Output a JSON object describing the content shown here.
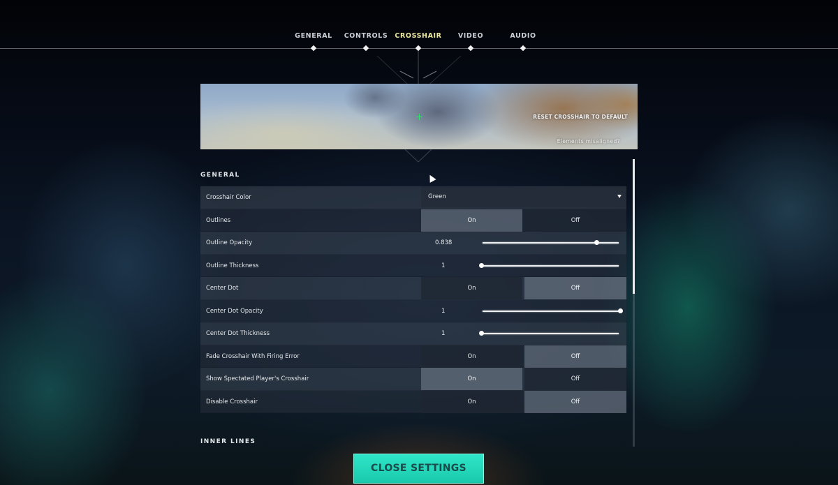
{
  "nav": {
    "tabs": [
      {
        "label": "GENERAL",
        "active": false
      },
      {
        "label": "CONTROLS",
        "active": false
      },
      {
        "label": "CROSSHAIR",
        "active": true
      },
      {
        "label": "VIDEO",
        "active": false
      },
      {
        "label": "AUDIO",
        "active": false
      }
    ]
  },
  "banner": {
    "reset_label": "RESET CROSSHAIR TO DEFAULT",
    "misaligned_label": "Elements misaligned?"
  },
  "sections": {
    "general_title": "GENERAL",
    "inner_lines_title": "INNER LINES"
  },
  "settings": {
    "crosshair_color": {
      "label": "Crosshair Color",
      "value": "Green"
    },
    "outlines": {
      "label": "Outlines",
      "on": "On",
      "off": "Off",
      "selected": "On"
    },
    "outline_opacity": {
      "label": "Outline Opacity",
      "value": "0.838",
      "fraction": 0.838
    },
    "outline_thickness": {
      "label": "Outline Thickness",
      "value": "1",
      "fraction": 0.0
    },
    "center_dot": {
      "label": "Center Dot",
      "on": "On",
      "off": "Off",
      "selected": "Off"
    },
    "center_dot_opacity": {
      "label": "Center Dot Opacity",
      "value": "1",
      "fraction": 1.0
    },
    "center_dot_thickness": {
      "label": "Center Dot Thickness",
      "value": "1",
      "fraction": 0.0
    },
    "fade_crosshair": {
      "label": "Fade Crosshair With Firing Error",
      "on": "On",
      "off": "Off",
      "selected": "Off"
    },
    "show_spectated": {
      "label": "Show Spectated Player's Crosshair",
      "on": "On",
      "off": "Off",
      "selected": "On"
    },
    "disable_crosshair": {
      "label": "Disable Crosshair",
      "on": "On",
      "off": "Off",
      "selected": "Off"
    }
  },
  "footer": {
    "close_label": "CLOSE SETTINGS"
  },
  "colors": {
    "accent_teal": "#1fd6b8",
    "active_tab": "#ece8a0",
    "preview_crosshair": "#2ee86a"
  }
}
